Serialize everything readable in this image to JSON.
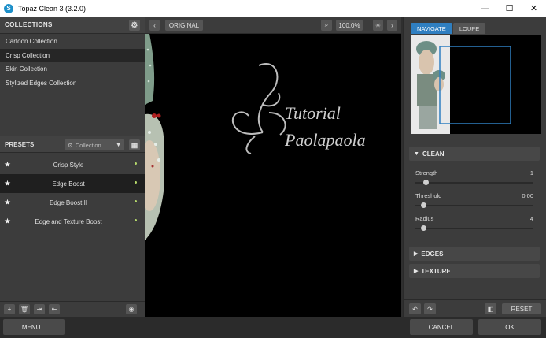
{
  "window": {
    "title": "Topaz Clean 3 (3.2.0)",
    "minimize": "—",
    "maximize": "☐",
    "close": "✕"
  },
  "collections": {
    "header": "COLLECTIONS",
    "items": [
      {
        "label": "Cartoon Collection"
      },
      {
        "label": "Crisp Collection"
      },
      {
        "label": "Skin Collection"
      },
      {
        "label": "Stylized Edges Collection"
      }
    ],
    "active_index": 1
  },
  "presets": {
    "header": "PRESETS",
    "dropdown_value": "Collection...",
    "items": [
      {
        "label": "Crisp Style"
      },
      {
        "label": "Edge Boost"
      },
      {
        "label": "Edge Boost II"
      },
      {
        "label": "Edge and Texture Boost"
      }
    ],
    "active_index": 1
  },
  "preview_toolbar": {
    "original_label": "ORIGINAL",
    "zoom_level": "100.0%"
  },
  "watermark": {
    "line1": "Tutorial",
    "line2": "Paolapaola"
  },
  "navigator": {
    "tabs": [
      {
        "label": "NAVIGATE"
      },
      {
        "label": "LOUPE"
      }
    ],
    "active_tab": 0
  },
  "clean": {
    "header": "CLEAN",
    "sliders": [
      {
        "label": "Strength",
        "value": "1",
        "position": 0.07
      },
      {
        "label": "Threshold",
        "value": "0.00",
        "position": 0.05
      },
      {
        "label": "Radius",
        "value": "4",
        "position": 0.05
      }
    ]
  },
  "edges": {
    "header": "EDGES"
  },
  "texture": {
    "header": "TEXTURE"
  },
  "right_toolbar": {
    "reset_label": "RESET"
  },
  "bottom": {
    "menu_label": "MENU...",
    "cancel_label": "CANCEL",
    "ok_label": "OK"
  },
  "colors": {
    "accent": "#2f7fc1",
    "panel": "#3c3c3c",
    "preset_dot": "#b5d96b"
  }
}
